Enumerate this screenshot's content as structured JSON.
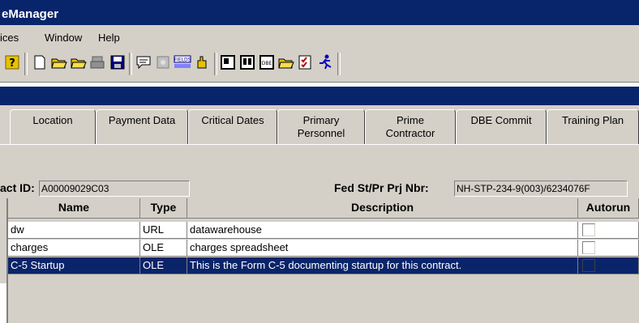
{
  "window": {
    "title": "eManager"
  },
  "menu": {
    "items": [
      "ices",
      "Window",
      "Help"
    ]
  },
  "toolbar": {
    "icons": [
      "help-icon",
      "new-document-icon",
      "open-folder-icon",
      "open-folder-2-icon",
      "print-icon",
      "save-icon",
      "comment-icon",
      "puzzle-icon",
      "fields-icon",
      "hand-icon",
      "report-icon",
      "report-2-icon",
      "dbe-icon",
      "folder-icon",
      "checklist-icon",
      "runner-icon"
    ]
  },
  "tabs": [
    {
      "label": "Location"
    },
    {
      "label": "Payment Data"
    },
    {
      "label": "Critical Dates"
    },
    {
      "label": "Primary Personnel"
    },
    {
      "label": "Prime Contractor"
    },
    {
      "label": "DBE Commit"
    },
    {
      "label": "Training Plan"
    }
  ],
  "fields": {
    "contract_id_label": "act ID:",
    "contract_id_value": "A00009029C03",
    "fed_label": "Fed St/Pr Prj Nbr:",
    "fed_value": "NH-STP-234-9(003)/6234076F"
  },
  "grid": {
    "columns": [
      "Name",
      "Type",
      "Description",
      "Autorun"
    ],
    "rows": [
      {
        "name": "dw",
        "type": "URL",
        "description": "datawarehouse",
        "autorun": false,
        "selected": false
      },
      {
        "name": "charges",
        "type": "OLE",
        "description": "charges spreadsheet",
        "autorun": false,
        "selected": false
      },
      {
        "name": "C-5 Startup",
        "type": "OLE",
        "description": "This is the Form C-5 documenting startup for this contract.",
        "autorun": false,
        "selected": true
      }
    ]
  },
  "colors": {
    "titlebar": "#08246b",
    "selection": "#0a246a",
    "chrome": "#d4d0c8"
  }
}
